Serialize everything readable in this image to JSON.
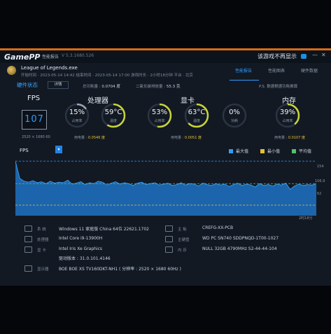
{
  "titlebar": {
    "logo": "GamePP",
    "app_title": "性能报告",
    "version": "V 5.3.1680.526",
    "notice": "该游戏不再显示",
    "min_label": "—",
    "close_label": "✕"
  },
  "session": {
    "game_name": "League of Legends.exe",
    "meta": "开始时间 · 2023-05-14 14:42    结束时间 · 2023-05-14 17:00    游戏时长 · 2小时18分钟    平台 · 北京"
  },
  "tabs": [
    {
      "label": "性能报告",
      "active": true
    },
    {
      "label": "性能图表",
      "active": false
    },
    {
      "label": "硬件数据",
      "active": false
    }
  ],
  "hardware_header": {
    "title": "硬件状态",
    "detail_button": "详情",
    "power_label": "总功耗量 :",
    "power_value": "0.0704 度",
    "carbon_label": "二氧化碳排放量 :",
    "carbon_value": "55.3 克",
    "note": "P.S. 数据根据功耗推算"
  },
  "fps": {
    "label": "FPS",
    "value": "107",
    "resolution": "2520 × 1680 60"
  },
  "cpu": {
    "title": "处理器",
    "usage": "15%",
    "usage_label": "占用率",
    "usage_level": 15,
    "temp": "59°C",
    "temp_label": "温度",
    "temp_level": 59,
    "power_label": "用电量 :",
    "power_value": "0.0546 度"
  },
  "gpu": {
    "title": "显卡",
    "usage": "53%",
    "usage_label": "占用率",
    "usage_level": 53,
    "temp": "63°C",
    "temp_label": "温度",
    "temp_level": 63,
    "third": "0%",
    "third_label": "功耗",
    "third_level": 0,
    "power_label": "用电量 :",
    "power_value": "0.0051 度"
  },
  "memory": {
    "title": "内存",
    "usage": "39%",
    "usage_label": "占用率",
    "usage_level": 39,
    "power_label": "用电量 :",
    "power_value": "0.0107 度"
  },
  "chart": {
    "selector": "FPS",
    "dropdown_glyph": "▾",
    "legend": [
      {
        "label": "最大值",
        "color": "#2f9cff"
      },
      {
        "label": "最小值",
        "color": "#e6c034"
      },
      {
        "label": "平均值",
        "color": "#4fc36b"
      }
    ],
    "time_label": "2时18分",
    "line_colors": {
      "max": "#2f9cff",
      "min": "#e6c034",
      "avg": "#4fc36b"
    }
  },
  "chart_data": {
    "type": "area",
    "series": [
      {
        "name": "FPS",
        "values": [
          154,
          118,
          112,
          110,
          113,
          109,
          111,
          107,
          112,
          108,
          110,
          109,
          114,
          106,
          108,
          111,
          105,
          109,
          107,
          112,
          110,
          104,
          108,
          111,
          106,
          109,
          107,
          103,
          108,
          110,
          105,
          107,
          109,
          104,
          106,
          108,
          103,
          105,
          109,
          104,
          107,
          106,
          102,
          108,
          105,
          103,
          107,
          104,
          106,
          101,
          105,
          108,
          103,
          106,
          104,
          100,
          107,
          103,
          105,
          102,
          106,
          104,
          108,
          95,
          102,
          106,
          103,
          105,
          104,
          107
        ]
      }
    ],
    "reference_lines": {
      "max": 154,
      "avg": 106.9,
      "min": 62
    },
    "ylim": [
      40,
      160
    ],
    "labels": {
      "max": "154",
      "avg": "106.9",
      "min": "62"
    }
  },
  "system": {
    "os_label": "系 统",
    "os_value": "Windows 11 家庭版 China 64位 22621.1702",
    "cpu_label": "处理器",
    "cpu_value": "Intel Core i9-13900H",
    "gpu_label": "显 卡",
    "gpu_value": "Intel Iris Xe Graphics",
    "driver_value": "驱动版本 : 31.0.101.4146",
    "display_label": "显示器",
    "display_value": "BOE BOE XS TV160DKT-NH1 ( 分辨率 : 2520 × 1680 60Hz )",
    "board_label": "主 板",
    "board_value": "CREFG-XX-PCB",
    "disk_label": "主硬盘",
    "disk_value": "WD PC SN740 SDDPNQD-1T00-1027",
    "mem_label": "内 存",
    "mem_value": "NULL 32GB 4790MHz S2-44-44-104"
  }
}
